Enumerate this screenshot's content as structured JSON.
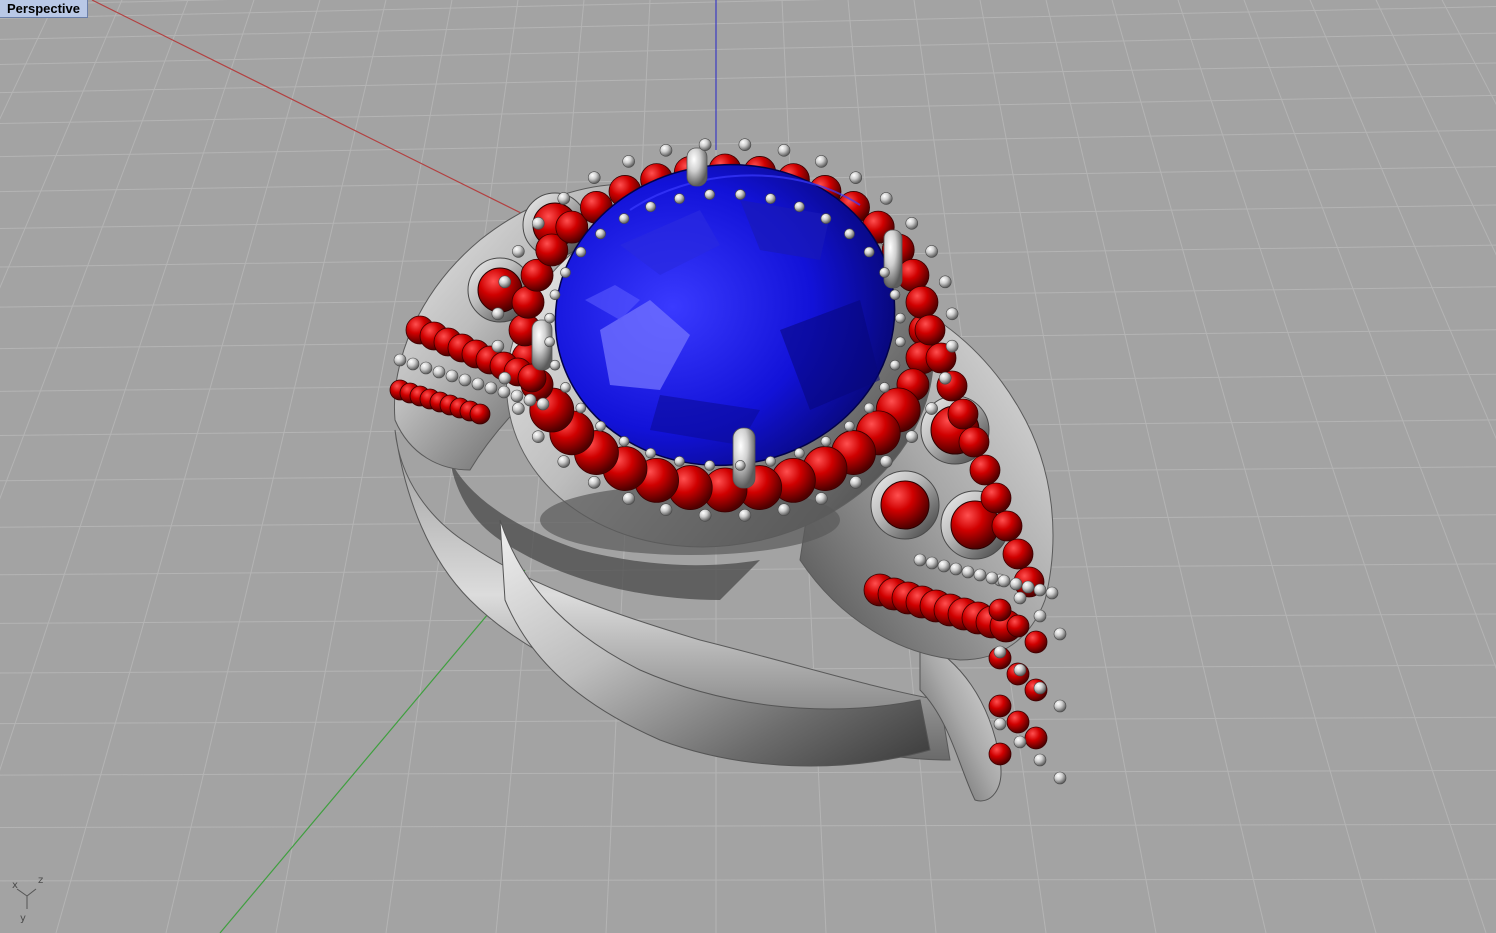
{
  "viewport": {
    "label": "Perspective",
    "background": "#a3a3a3",
    "grid_color": "#b3b3b3",
    "x_axis_color": "#b34040",
    "y_axis_color": "#40a040",
    "z_axis_color": "#4040c0"
  },
  "model": {
    "metal_color": "#c8c8c8",
    "center_stone_color": "#1010d0",
    "accent_stone_color": "#c00000",
    "center_stone_icon": "blue-gem-icon",
    "accent_stone_icon": "red-gem-icon"
  },
  "axis_gizmo": {
    "x": "x",
    "y": "y",
    "z": "z"
  }
}
